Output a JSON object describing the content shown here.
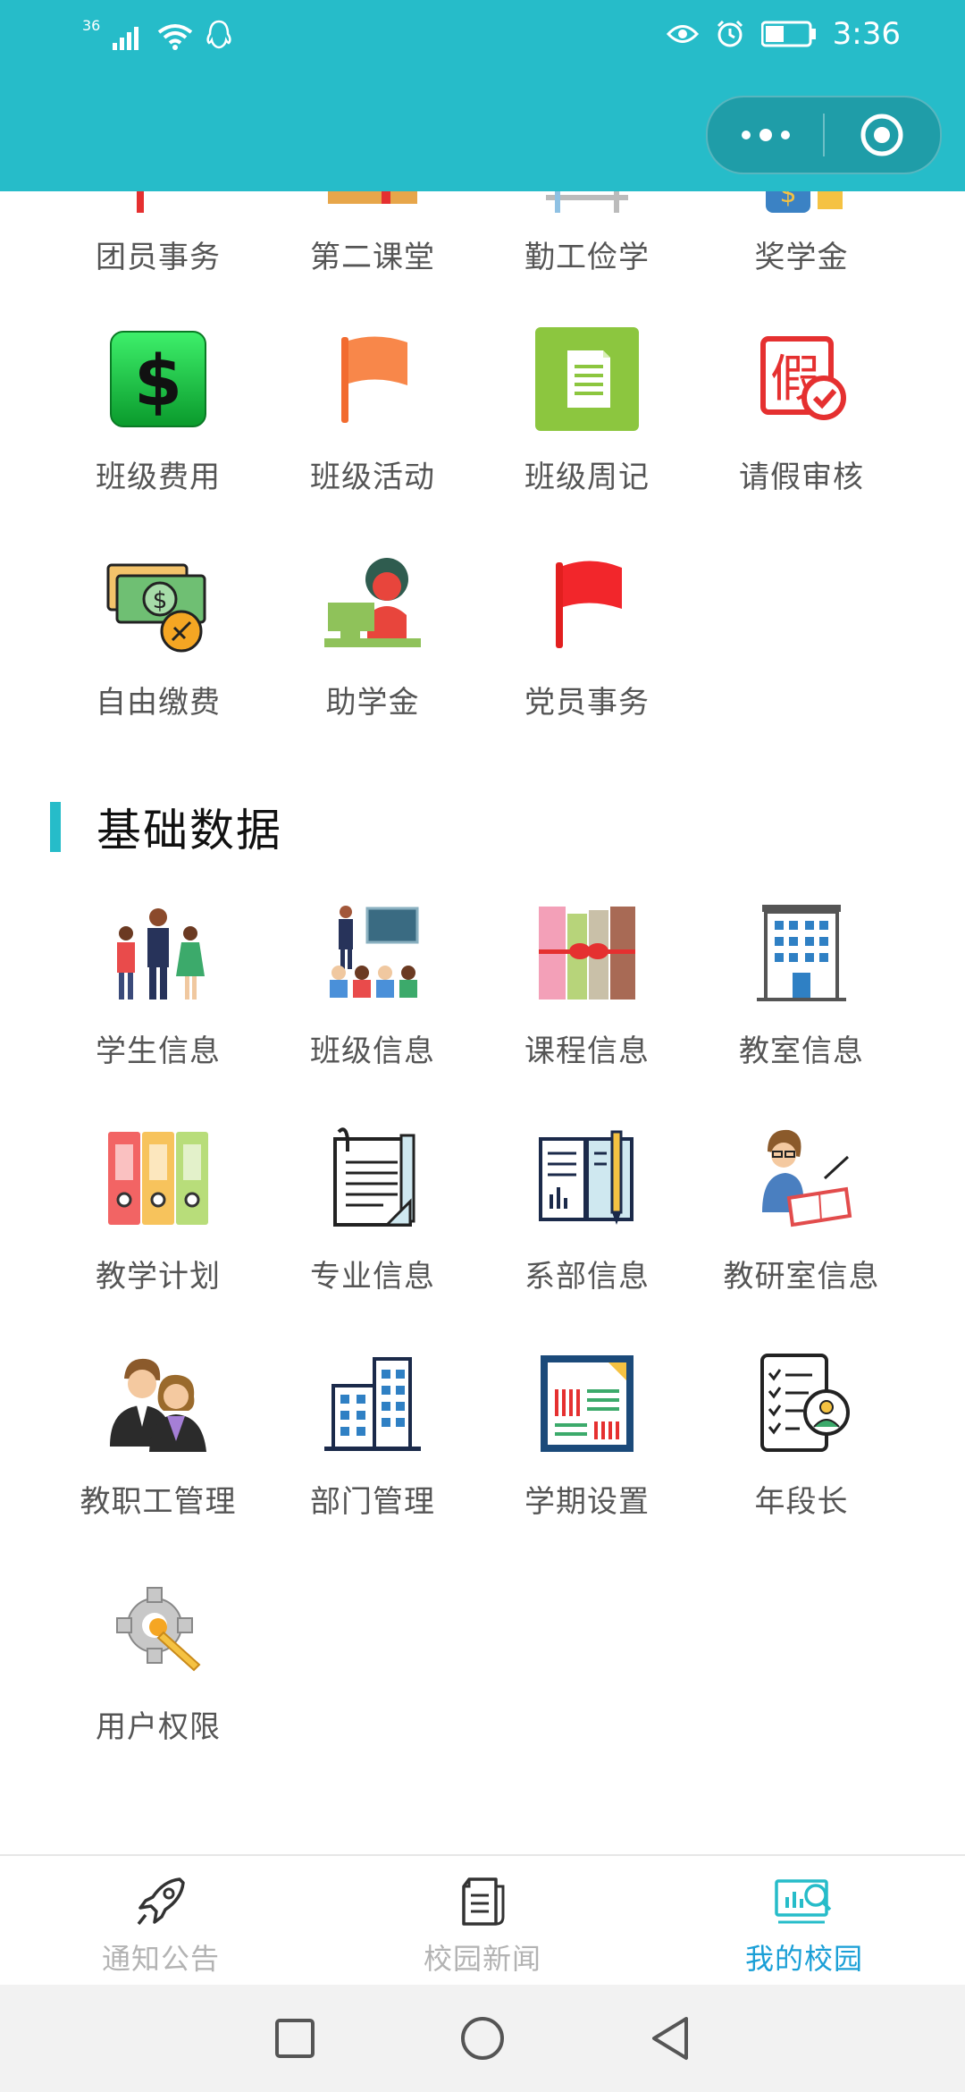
{
  "status_bar": {
    "network": "36",
    "time": "3:36"
  },
  "sections": {
    "partial_row": [
      "团员事务",
      "第二课堂",
      "勤工俭学",
      "奖学金"
    ],
    "row2": [
      "班级费用",
      "班级活动",
      "班级周记",
      "请假审核"
    ],
    "row3": [
      "自由缴费",
      "助学金",
      "党员事务"
    ],
    "basic_data_title": "基础数据",
    "basic_row1": [
      "学生信息",
      "班级信息",
      "课程信息",
      "教室信息"
    ],
    "basic_row2": [
      "教学计划",
      "专业信息",
      "系部信息",
      "教研室信息"
    ],
    "basic_row3": [
      "教职工管理",
      "部门管理",
      "学期设置",
      "年段长"
    ],
    "basic_row4": [
      "用户权限"
    ]
  },
  "icons": {
    "dollar_icon": "dollar-icon",
    "leave_icon_char": "假"
  },
  "tabbar": {
    "tabs": [
      {
        "label": "通知公告",
        "icon": "rocket-icon"
      },
      {
        "label": "校园新闻",
        "icon": "news-icon"
      },
      {
        "label": "我的校园",
        "icon": "campus-icon"
      }
    ],
    "active_index": 2
  },
  "colors": {
    "header": "#26bcc9",
    "accent": "#1a9fd6",
    "label": "#555555",
    "inactive_tab": "#b3b3b3"
  }
}
